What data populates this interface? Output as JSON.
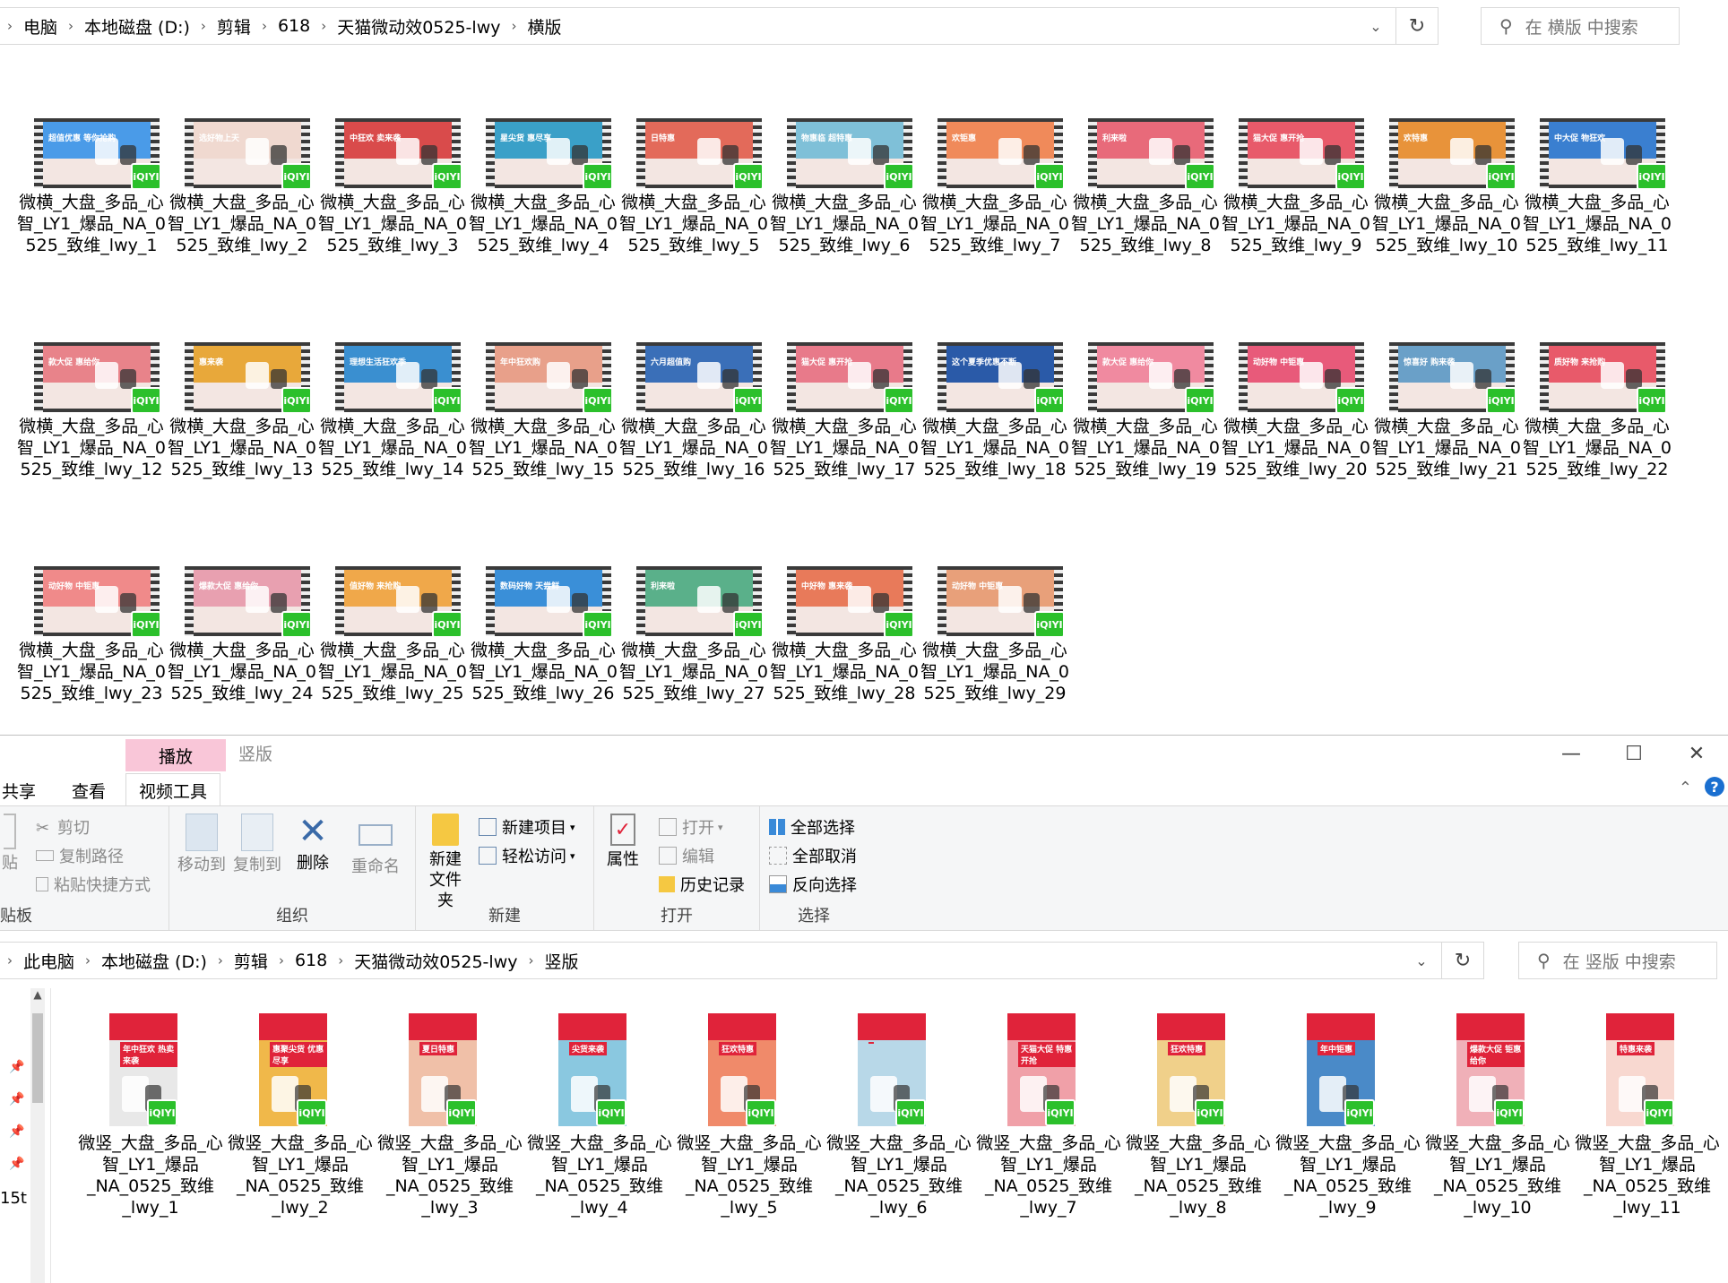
{
  "top": {
    "breadcrumb": [
      "电脑",
      "本地磁盘 (D:)",
      "剪辑",
      "618",
      "天猫微动效0525-lwy",
      "横版"
    ],
    "search_placeholder": "在 横版 中搜索",
    "files": [
      {
        "name": "微横_大盘_多品_心智_LY1_爆品_NA_0525_致维_lwy_1",
        "caption": "超值优惠 等你抢购",
        "color": "#4a9be8"
      },
      {
        "name": "微横_大盘_多品_心智_LY1_爆品_NA_0525_致维_lwy_2",
        "caption": "选好物上天",
        "color": "#f0d9d0"
      },
      {
        "name": "微横_大盘_多品_心智_LY1_爆品_NA_0525_致维_lwy_3",
        "caption": "中狂欢 卖来袭",
        "color": "#d94b4b"
      },
      {
        "name": "微横_大盘_多品_心智_LY1_爆品_NA_0525_致维_lwy_4",
        "caption": "星尖货 惠尽享",
        "color": "#3aa0c8"
      },
      {
        "name": "微横_大盘_多品_心智_LY1_爆品_NA_0525_致维_lwy_5",
        "caption": "日特惠",
        "color": "#e36a5a"
      },
      {
        "name": "微横_大盘_多品_心智_LY1_爆品_NA_0525_致维_lwy_6",
        "caption": "物惠临 超特惠",
        "color": "#7fc0d8"
      },
      {
        "name": "微横_大盘_多品_心智_LY1_爆品_NA_0525_致维_lwy_7",
        "caption": "欢钜惠",
        "color": "#f08a5a"
      },
      {
        "name": "微横_大盘_多品_心智_LY1_爆品_NA_0525_致维_lwy_8",
        "caption": "利来啦",
        "color": "#e86a7a"
      },
      {
        "name": "微横_大盘_多品_心智_LY1_爆品_NA_0525_致维_lwy_9",
        "caption": "猫大促 惠开抢",
        "color": "#e85a6a"
      },
      {
        "name": "微横_大盘_多品_心智_LY1_爆品_NA_0525_致维_lwy_10",
        "caption": "欢特惠",
        "color": "#e8933a"
      },
      {
        "name": "微横_大盘_多品_心智_LY1_爆品_NA_0525_致维_lwy_11",
        "caption": "中大促 物狂欢",
        "color": "#3a7fd0"
      },
      {
        "name": "微横_大盘_多品_心智_LY1_爆品_NA_0525_致维_lwy_12",
        "caption": "款大促 惠给你",
        "color": "#e8838a"
      },
      {
        "name": "微横_大盘_多品_心智_LY1_爆品_NA_0525_致维_lwy_13",
        "caption": "惠来袭",
        "color": "#e8a83a"
      },
      {
        "name": "微横_大盘_多品_心智_LY1_爆品_NA_0525_致维_lwy_14",
        "caption": "理想生活狂欢季",
        "color": "#3a8fd0"
      },
      {
        "name": "微横_大盘_多品_心智_LY1_爆品_NA_0525_致维_lwy_15",
        "caption": "年中狂欢购",
        "color": "#e8a08a"
      },
      {
        "name": "微横_大盘_多品_心智_LY1_爆品_NA_0525_致维_lwy_16",
        "caption": "六月超值购",
        "color": "#3a6fb8"
      },
      {
        "name": "微横_大盘_多品_心智_LY1_爆品_NA_0525_致维_lwy_17",
        "caption": "猫大促 惠开抢",
        "color": "#e87a8a"
      },
      {
        "name": "微横_大盘_多品_心智_LY1_爆品_NA_0525_致维_lwy_18",
        "caption": "这个夏季优惠不断",
        "color": "#2a5aa8"
      },
      {
        "name": "微横_大盘_多品_心智_LY1_爆品_NA_0525_致维_lwy_19",
        "caption": "款大促 惠给你",
        "color": "#f08aa0"
      },
      {
        "name": "微横_大盘_多品_心智_LY1_爆品_NA_0525_致维_lwy_20",
        "caption": "动好物 中钜惠",
        "color": "#e85a7a"
      },
      {
        "name": "微横_大盘_多品_心智_LY1_爆品_NA_0525_致维_lwy_21",
        "caption": "惊喜好 购来袭",
        "color": "#6aa0c8"
      },
      {
        "name": "微横_大盘_多品_心智_LY1_爆品_NA_0525_致维_lwy_22",
        "caption": "质好物 来抢购",
        "color": "#e85a6a"
      },
      {
        "name": "微横_大盘_多品_心智_LY1_爆品_NA_0525_致维_lwy_23",
        "caption": "动好物 中钜惠",
        "color": "#f08a8a"
      },
      {
        "name": "微横_大盘_多品_心智_LY1_爆品_NA_0525_致维_lwy_24",
        "caption": "爆款大促 惠给你",
        "color": "#e8a0b0"
      },
      {
        "name": "微横_大盘_多品_心智_LY1_爆品_NA_0525_致维_lwy_25",
        "caption": "值好物 来抢购",
        "color": "#f0a84a"
      },
      {
        "name": "微横_大盘_多品_心智_LY1_爆品_NA_0525_致维_lwy_26",
        "caption": "数码好物 天尝鲜",
        "color": "#3a8fd8"
      },
      {
        "name": "微横_大盘_多品_心智_LY1_爆品_NA_0525_致维_lwy_27",
        "caption": "利来啦",
        "color": "#5ab08a"
      },
      {
        "name": "微横_大盘_多品_心智_LY1_爆品_NA_0525_致维_lwy_28",
        "caption": "中好物 惠来袭",
        "color": "#e87a5a"
      },
      {
        "name": "微横_大盘_多品_心智_LY1_爆品_NA_0525_致维_lwy_29",
        "caption": "动好物 中钜惠",
        "color": "#e8a07a"
      }
    ]
  },
  "bottom": {
    "context_tab": "播放",
    "window_title": "竖版",
    "tabs": {
      "share": "共享",
      "view": "查看",
      "video_tools": "视频工具"
    },
    "ribbon": {
      "clipboard": {
        "paste": "贴",
        "cut": "剪切",
        "copy_path": "复制路径",
        "paste_shortcut": "粘贴快捷方式",
        "group": "贴板"
      },
      "organize": {
        "move_to": "移动到",
        "copy_to": "复制到",
        "delete": "删除",
        "rename": "重命名",
        "group": "组织"
      },
      "new": {
        "new_folder_line1": "新建",
        "new_folder_line2": "文件夹",
        "new_item": "新建项目",
        "easy_access": "轻松访问",
        "group": "新建"
      },
      "open": {
        "properties": "属性",
        "open": "打开",
        "edit": "编辑",
        "history": "历史记录",
        "group": "打开"
      },
      "select": {
        "select_all": "全部选择",
        "select_none": "全部取消",
        "invert": "反向选择",
        "group": "选择"
      }
    },
    "breadcrumb": [
      "此电脑",
      "本地磁盘 (D:)",
      "剪辑",
      "618",
      "天猫微动效0525-lwy",
      "竖版"
    ],
    "search_placeholder": "在 竖版 中搜索",
    "nav_partial_label": "15t",
    "files": [
      {
        "name": "微竖_大盘_多品_心智_LY1_爆品_NA_0525_致维_lwy_1",
        "caption": "年中狂欢 热卖来袭",
        "color": "#e8e8e8"
      },
      {
        "name": "微竖_大盘_多品_心智_LY1_爆品_NA_0525_致维_lwy_2",
        "caption": "惠聚尖货 优惠尽享",
        "color": "#f0b84a"
      },
      {
        "name": "微竖_大盘_多品_心智_LY1_爆品_NA_0525_致维_lwy_3",
        "caption": "夏日特惠",
        "color": "#f0c0a8"
      },
      {
        "name": "微竖_大盘_多品_心智_LY1_爆品_NA_0525_致维_lwy_4",
        "caption": "尖货来袭",
        "color": "#8ac8e0"
      },
      {
        "name": "微竖_大盘_多品_心智_LY1_爆品_NA_0525_致维_lwy_5",
        "caption": "狂欢特惠",
        "color": "#f08a6a"
      },
      {
        "name": "微竖_大盘_多品_心智_LY1_爆品_NA_0525_致维_lwy_6",
        "caption": "",
        "color": "#b8d8e8"
      },
      {
        "name": "微竖_大盘_多品_心智_LY1_爆品_NA_0525_致维_lwy_7",
        "caption": "天猫大促 特惠开抢",
        "color": "#f0a0a8"
      },
      {
        "name": "微竖_大盘_多品_心智_LY1_爆品_NA_0525_致维_lwy_8",
        "caption": "狂欢特惠",
        "color": "#f0d08a"
      },
      {
        "name": "微竖_大盘_多品_心智_LY1_爆品_NA_0525_致维_lwy_9",
        "caption": "年中钜惠",
        "color": "#4a8ac8"
      },
      {
        "name": "微竖_大盘_多品_心智_LY1_爆品_NA_0525_致维_lwy_10",
        "caption": "爆款大促 钜惠给你",
        "color": "#f0b0b8"
      },
      {
        "name": "微竖_大盘_多品_心智_LY1_爆品_NA_0525_致维_lwy_11",
        "caption": "特惠来袭",
        "color": "#f8d8d0"
      }
    ]
  },
  "badge_text": "iQIYI",
  "colors": {
    "badge": "#2bc02b",
    "context_tab": "#f9c6d8",
    "accent_red": "#e0233a"
  }
}
